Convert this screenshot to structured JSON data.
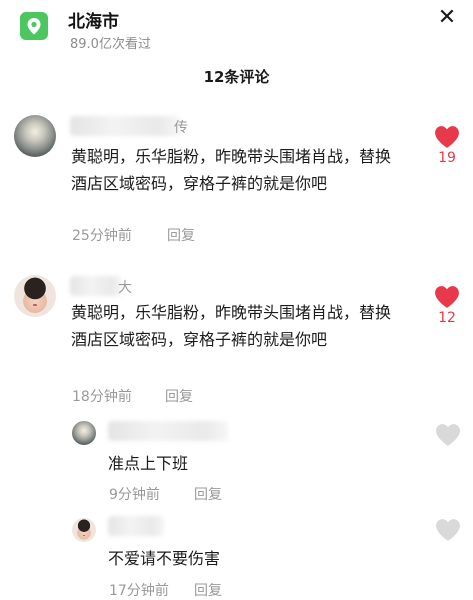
{
  "header": {
    "location_name": "北海市",
    "views": "89.0亿次看过",
    "comment_count_title": "12条评论",
    "close_symbol": "✕"
  },
  "comments": [
    {
      "username_visible": "传",
      "text": "黄聪明，乐华脂粉，昨晚带头围堵肖战，替换酒店区域密码，穿格子裤的就是你吧",
      "time": "25分钟前",
      "reply_label": "回复",
      "likes": "19",
      "liked": true
    },
    {
      "username_visible": "大",
      "text": "黄聪明，乐华脂粉，昨晚带头围堵肖战，替换酒店区域密码，穿格子裤的就是你吧",
      "time": "18分钟前",
      "reply_label": "回复",
      "likes": "12",
      "liked": true,
      "replies": [
        {
          "text": "准点上下班",
          "time": "9分钟前",
          "reply_label": "回复",
          "liked": false
        },
        {
          "text": "不爱请不要伤害",
          "time": "17分钟前",
          "reply_label": "回复",
          "liked": false
        }
      ]
    }
  ],
  "colors": {
    "accent_green": "#4cc75f",
    "like_red": "#e8394a",
    "muted": "#9a9a9a"
  }
}
